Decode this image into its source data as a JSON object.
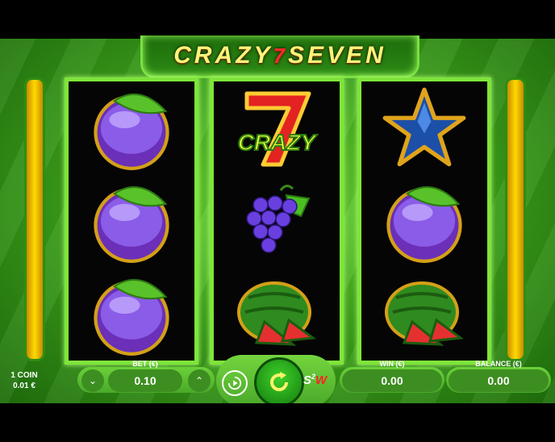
{
  "title": {
    "before": "CRAZY",
    "seven": "7",
    "after": "SEVEN"
  },
  "reels": [
    {
      "symbols": [
        "plum-icon",
        "plum-icon",
        "plum-icon"
      ]
    },
    {
      "symbols": [
        "crazy-seven-icon",
        "grapes-icon",
        "watermelon-icon"
      ]
    },
    {
      "symbols": [
        "blue-star-icon",
        "plum-icon",
        "watermelon-icon"
      ]
    }
  ],
  "crazy_label": "CRAZY",
  "coin": {
    "line1": "1 COIN",
    "line2": "0.01 €"
  },
  "bet": {
    "label": "BET (€)",
    "value": "0.10"
  },
  "win": {
    "label": "WIN (€)",
    "value": "0.00"
  },
  "balance": {
    "label": "BALANCE (€)",
    "value": "0.00"
  },
  "s2w": {
    "s": "S",
    "sup": "2",
    "w": "W"
  },
  "colors": {
    "frame_green": "#3fa51c",
    "reel_border": "#7ee53a",
    "title_yellow": "#fff27a",
    "seven_red": "#ff2a2a",
    "spin_green": "#3ed12a"
  }
}
